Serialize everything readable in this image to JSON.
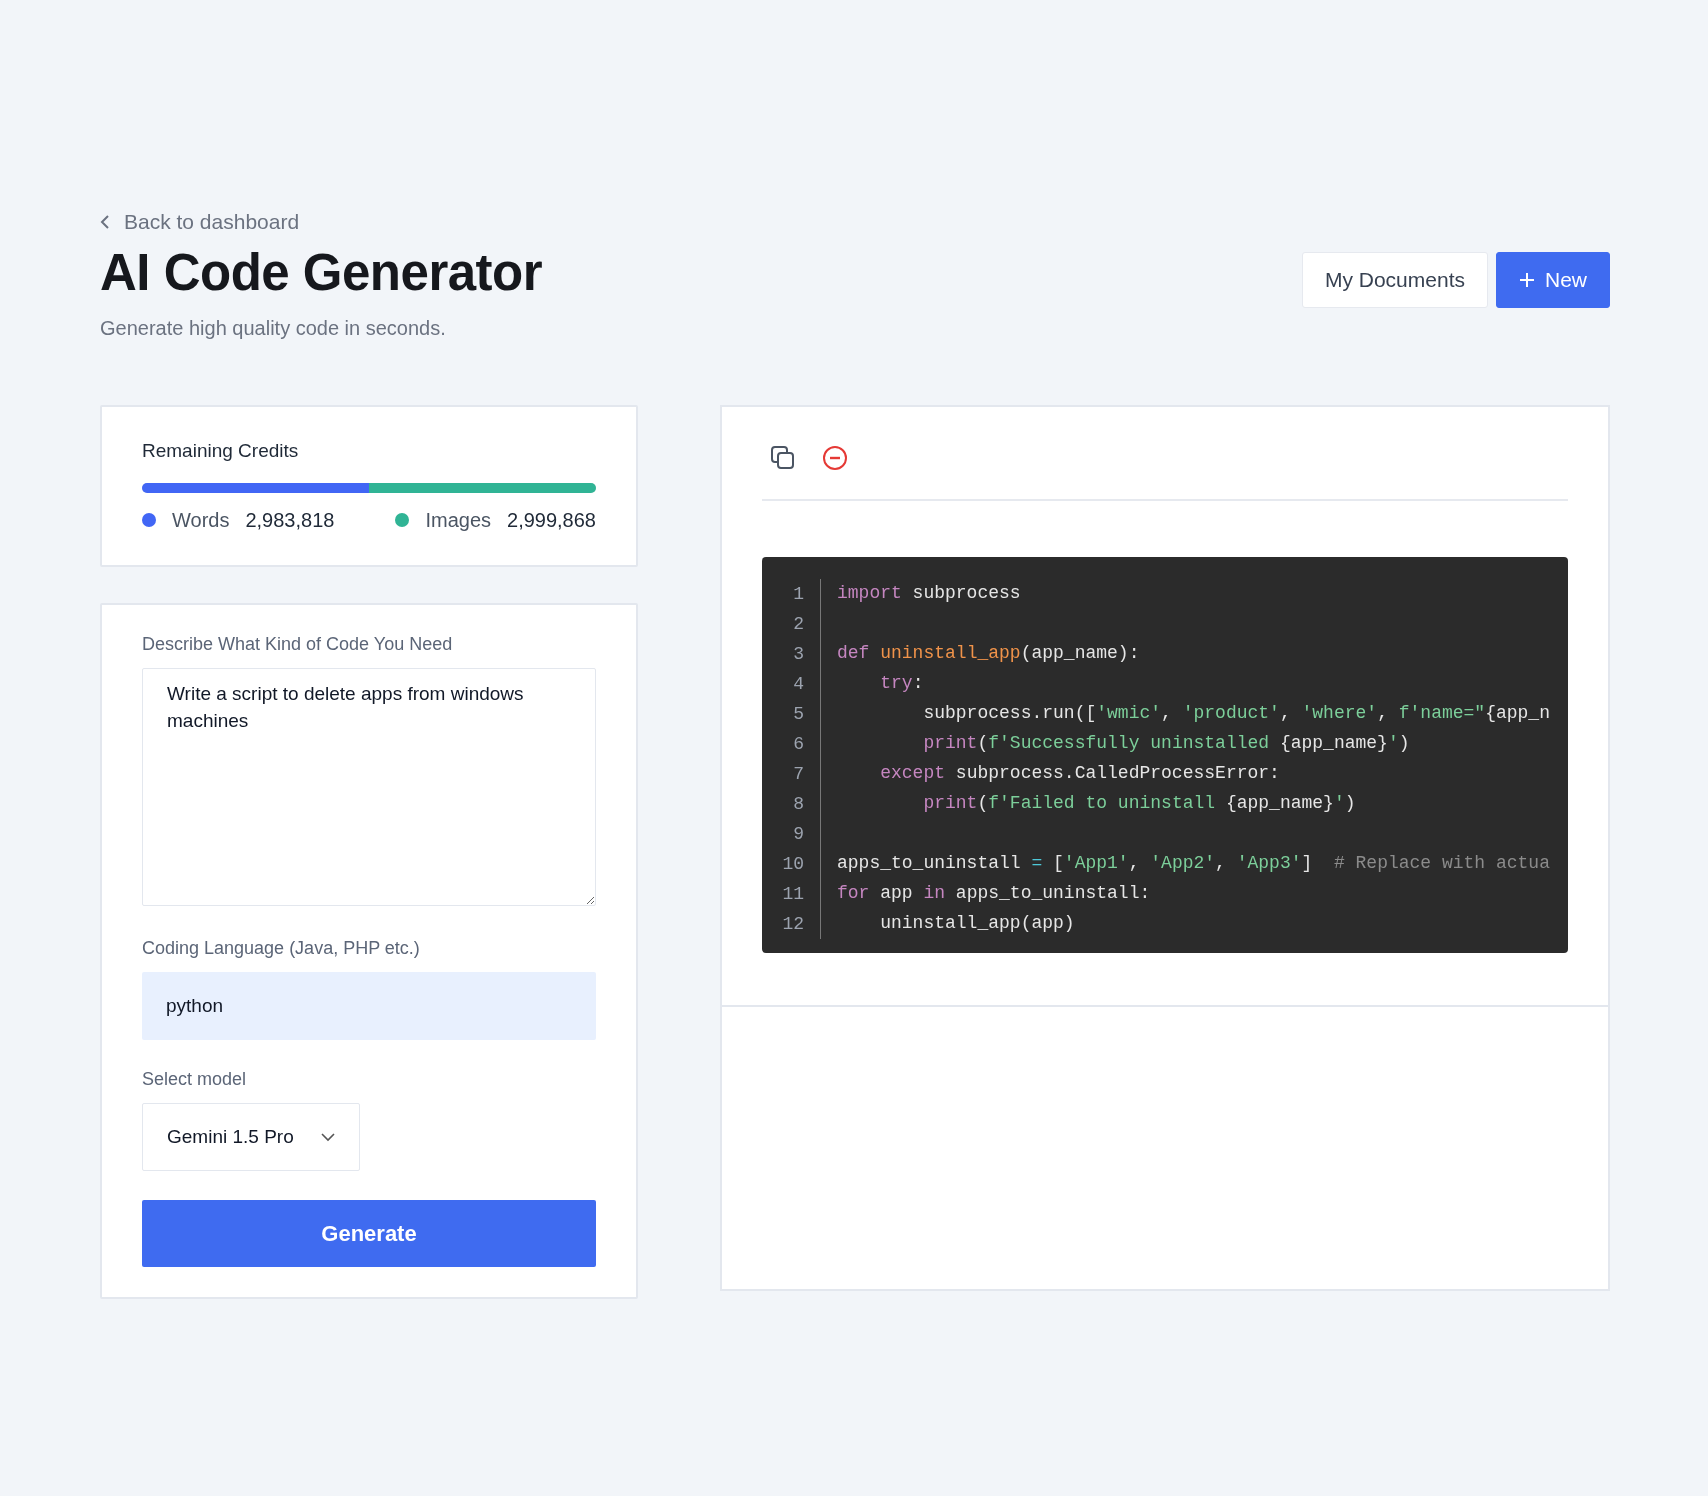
{
  "header": {
    "back_link": "Back to dashboard",
    "title": "AI Code Generator",
    "subtitle": "Generate high quality code in seconds.",
    "buttons": [
      {
        "label": "My Documents",
        "kind": "secondary"
      },
      {
        "label": "New",
        "kind": "primary"
      }
    ]
  },
  "credits": {
    "title": "Remaining Credits",
    "items": [
      {
        "label": "Words",
        "value": "2,983,818",
        "color": "#4166f5",
        "level": 0.5
      },
      {
        "label": "Images",
        "value": "2,999,868",
        "color": "#30b495",
        "level": 0.5
      }
    ]
  },
  "form": {
    "description_label": "Describe What Kind of Code You Need",
    "description_value": "Write a script to delete apps from windows machines",
    "language_label": "Coding Language (Java, PHP etc.)",
    "language_value": "python",
    "model_label": "Select model",
    "model_value": "Gemini 1.5 Pro",
    "submit": "Generate"
  },
  "output": {
    "toolbar": [
      {
        "kind": "copy"
      },
      {
        "kind": "remove"
      }
    ],
    "code_lines": [
      {
        "number": "1",
        "tokens": [
          {
            "kind": "kw",
            "text": "import"
          },
          {
            "kind": "plain",
            "text": " subprocess"
          }
        ]
      },
      {
        "number": "2"
      },
      {
        "number": "3",
        "tokens": [
          {
            "kind": "kw",
            "text": "def "
          },
          {
            "kind": "fn",
            "text": "uninstall_app"
          },
          {
            "kind": "plain",
            "text": "(app_name):"
          }
        ]
      },
      {
        "number": "4",
        "tokens": [
          {
            "kind": "kw",
            "text": "    try"
          },
          {
            "kind": "plain",
            "text": ":"
          }
        ]
      },
      {
        "number": "5",
        "tokens": [
          {
            "kind": "plain",
            "text": "        subprocess.run(["
          },
          {
            "kind": "str",
            "text": "'wmic'"
          },
          {
            "kind": "plain",
            "text": ", "
          },
          {
            "kind": "str",
            "text": "'product'"
          },
          {
            "kind": "plain",
            "text": ", "
          },
          {
            "kind": "str",
            "text": "'where'"
          },
          {
            "kind": "plain",
            "text": ", "
          },
          {
            "kind": "str",
            "text": "f'name=\""
          },
          {
            "kind": "plain",
            "text": "{app_n"
          }
        ]
      },
      {
        "number": "6",
        "tokens": [
          {
            "kind": "kw",
            "text": "        print"
          },
          {
            "kind": "plain",
            "text": "("
          },
          {
            "kind": "str",
            "text": "f'Successfully uninstalled "
          },
          {
            "kind": "plain",
            "text": "{app_name}"
          },
          {
            "kind": "str",
            "text": "'"
          },
          {
            "kind": "plain",
            "text": ")"
          }
        ]
      },
      {
        "number": "7",
        "tokens": [
          {
            "kind": "kw",
            "text": "    except"
          },
          {
            "kind": "plain",
            "text": " subprocess.CalledProcessError:"
          }
        ]
      },
      {
        "number": "8",
        "tokens": [
          {
            "kind": "kw",
            "text": "        print"
          },
          {
            "kind": "plain",
            "text": "("
          },
          {
            "kind": "str",
            "text": "f'Failed to uninstall "
          },
          {
            "kind": "plain",
            "text": "{app_name}"
          },
          {
            "kind": "str",
            "text": "'"
          },
          {
            "kind": "plain",
            "text": ")"
          }
        ]
      },
      {
        "number": "9"
      },
      {
        "number": "10",
        "tokens": [
          {
            "kind": "plain",
            "text": "apps_to_uninstall "
          },
          {
            "kind": "op",
            "text": "="
          },
          {
            "kind": "plain",
            "text": " ["
          },
          {
            "kind": "str",
            "text": "'App1'"
          },
          {
            "kind": "plain",
            "text": ", "
          },
          {
            "kind": "str",
            "text": "'App2'"
          },
          {
            "kind": "plain",
            "text": ", "
          },
          {
            "kind": "str",
            "text": "'App3'"
          },
          {
            "kind": "plain",
            "text": "]  "
          },
          {
            "kind": "cm",
            "text": "# Replace with actua"
          }
        ]
      },
      {
        "number": "11",
        "tokens": [
          {
            "kind": "kw",
            "text": "for"
          },
          {
            "kind": "plain",
            "text": " app "
          },
          {
            "kind": "kw",
            "text": "in"
          },
          {
            "kind": "plain",
            "text": " apps_to_uninstall:"
          }
        ]
      },
      {
        "number": "12",
        "tokens": [
          {
            "kind": "plain",
            "text": "    uninstall_app(app)"
          }
        ]
      }
    ]
  }
}
